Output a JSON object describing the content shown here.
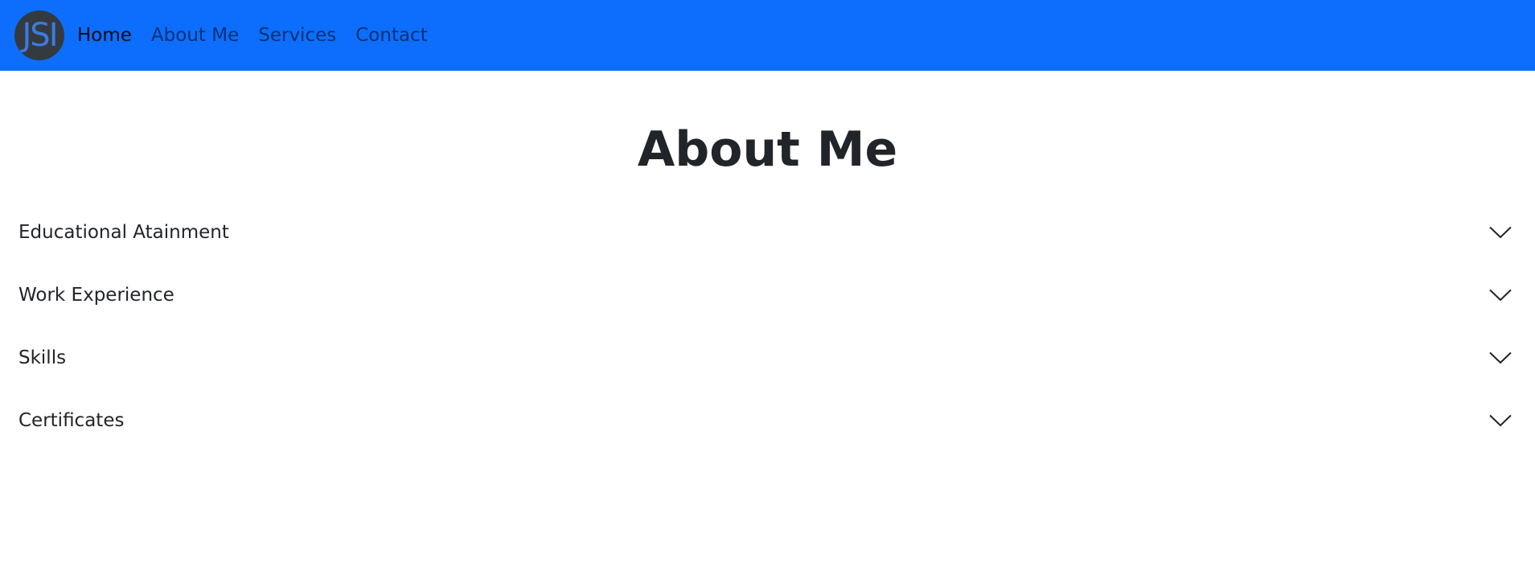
{
  "navbar": {
    "logo_text": "JSI",
    "links": [
      {
        "label": "Home",
        "active": true
      },
      {
        "label": "About Me",
        "active": false
      },
      {
        "label": "Services",
        "active": false
      },
      {
        "label": "Contact",
        "active": false
      }
    ],
    "background_color": "#0d6efd"
  },
  "main": {
    "title": "About Me",
    "accordion": [
      {
        "label": "Educational Atainment",
        "icon": "chevron-down-icon",
        "expanded": false
      },
      {
        "label": "Work Experience",
        "icon": "chevron-down-icon",
        "expanded": false
      },
      {
        "label": "Skills",
        "icon": "chevron-down-icon",
        "expanded": false
      },
      {
        "label": "Certificates",
        "icon": "chevron-down-icon",
        "expanded": false
      }
    ]
  }
}
